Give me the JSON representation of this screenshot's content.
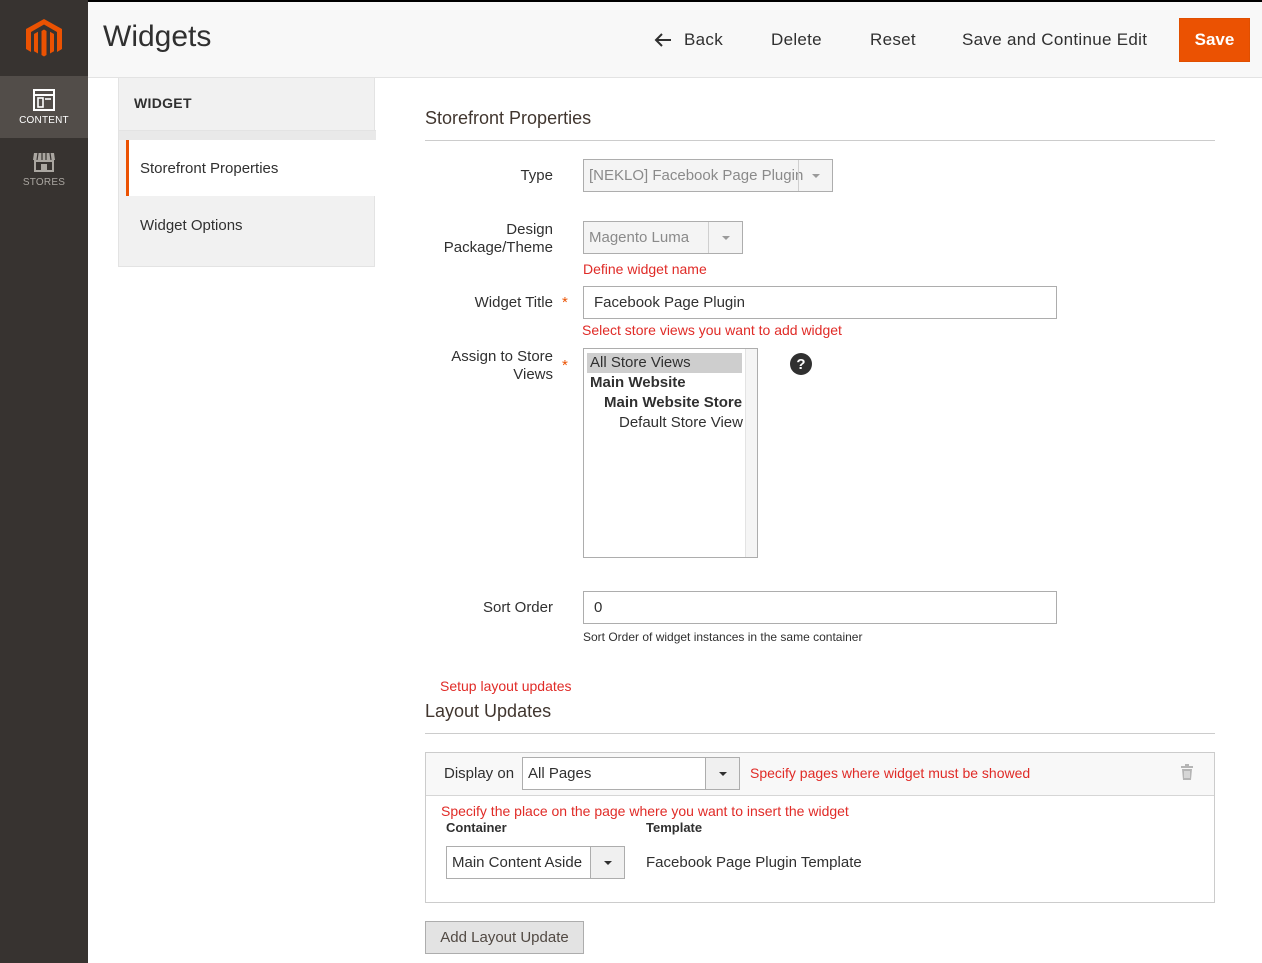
{
  "header": {
    "title": "Widgets",
    "back": "Back",
    "delete": "Delete",
    "reset": "Reset",
    "save_continue": "Save and Continue Edit",
    "save": "Save"
  },
  "sidebar": {
    "items": [
      {
        "label": "CONTENT",
        "icon": "content-icon",
        "active": true
      },
      {
        "label": "STORES",
        "icon": "stores-icon",
        "active": false
      }
    ]
  },
  "tabs": {
    "title": "WIDGET",
    "items": [
      {
        "label": "Storefront Properties",
        "active": true
      },
      {
        "label": "Widget Options",
        "active": false
      }
    ]
  },
  "storefront": {
    "section_title": "Storefront Properties",
    "type_label": "Type",
    "type_value": "[NEKLO] Facebook Page Plugin",
    "design_label_1": "Design",
    "design_label_2": "Package/Theme",
    "design_value": "Magento Luma",
    "widget_name_note": "Define widget name",
    "title_label": "Widget Title",
    "title_value": "Facebook Page Plugin",
    "store_views_note": "Select store views you want to add widget",
    "assign_label_1": "Assign to Store",
    "assign_label_2": "Views",
    "store_views": [
      "All Store Views",
      "Main Website",
      "Main Website Store",
      "Default Store View"
    ],
    "help": "?",
    "sort_label": "Sort Order",
    "sort_value": "0",
    "sort_note": "Sort Order of widget instances in the same container"
  },
  "layout": {
    "setup_note": "Setup layout updates",
    "section_title": "Layout Updates",
    "display_on_label": "Display on",
    "display_on_value": "All Pages",
    "display_note": "Specify pages where widget must be showed",
    "place_note": "Specify the place on the page where you want to insert the widget",
    "container_label": "Container",
    "template_label": "Template",
    "container_value": "Main Content Aside",
    "template_value": "Facebook Page Plugin Template",
    "add_button": "Add Layout Update"
  },
  "colors": {
    "accent": "#eb5202",
    "sidebar": "#373330",
    "note_red": "#e02b27"
  }
}
